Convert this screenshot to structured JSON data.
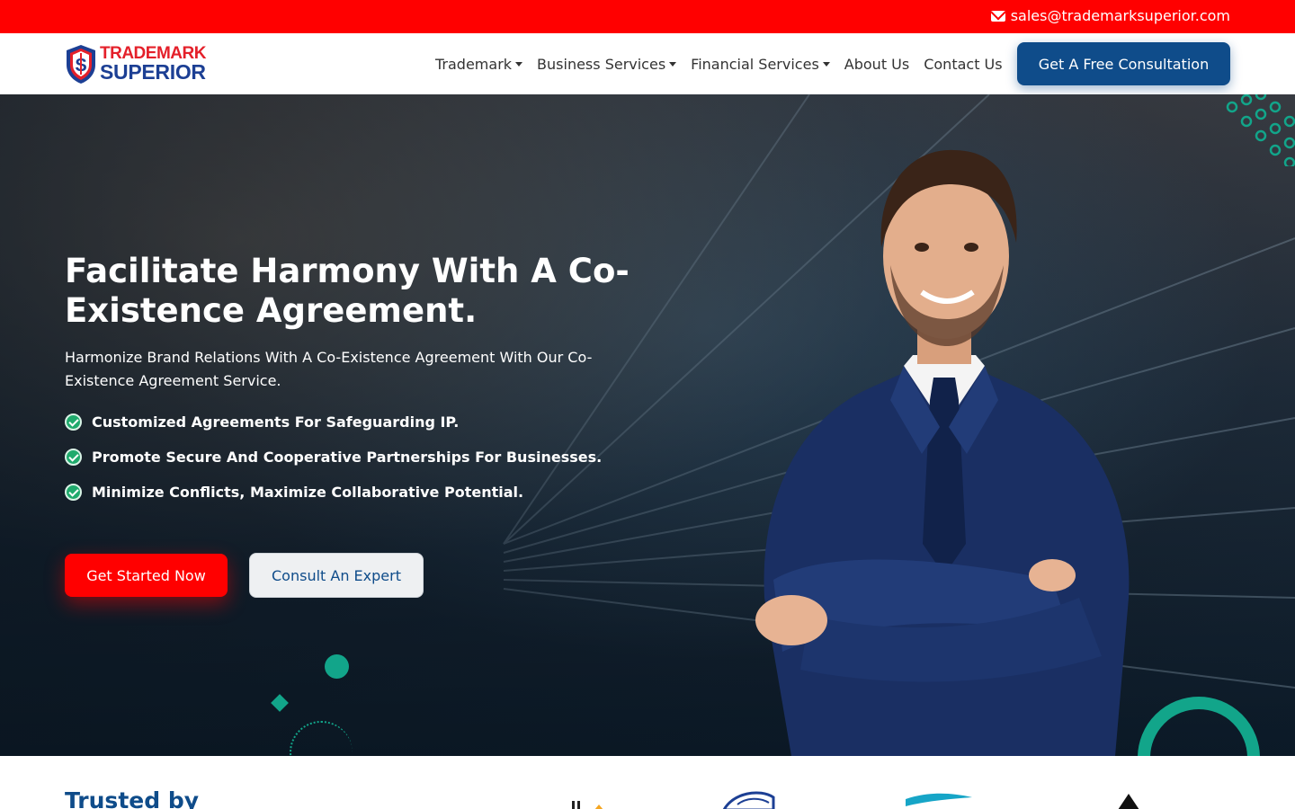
{
  "topbar": {
    "email": "sales@trademarksuperior.com",
    "icon": "envelope-icon",
    "bg_color": "#ff0000"
  },
  "logo": {
    "line1": "TRADEMARK",
    "line2": "SUPERIOR"
  },
  "nav": {
    "items": [
      {
        "label": "Trademark",
        "dropdown": true
      },
      {
        "label": "Business Services",
        "dropdown": true
      },
      {
        "label": "Financial Services",
        "dropdown": true
      },
      {
        "label": "About Us",
        "dropdown": false
      },
      {
        "label": "Contact Us",
        "dropdown": false
      }
    ],
    "cta_label": "Get A Free Consultation",
    "cta_color": "#0f4c8a"
  },
  "hero": {
    "title": "Facilitate Harmony With A Co-Existence Agreement.",
    "subtitle": "Harmonize Brand Relations With A Co-Existence Agreement With Our Co-Existence Agreement Service.",
    "features": [
      "Customized Agreements For Safeguarding IP.",
      "Promote Secure And Cooperative Partnerships For Businesses.",
      "Minimize Conflicts, Maximize Collaborative Potential."
    ],
    "primary_button": "Get Started Now",
    "secondary_button": "Consult An Expert",
    "accent_color": "#12a58a"
  },
  "trusted": {
    "title": "Trusted by"
  }
}
